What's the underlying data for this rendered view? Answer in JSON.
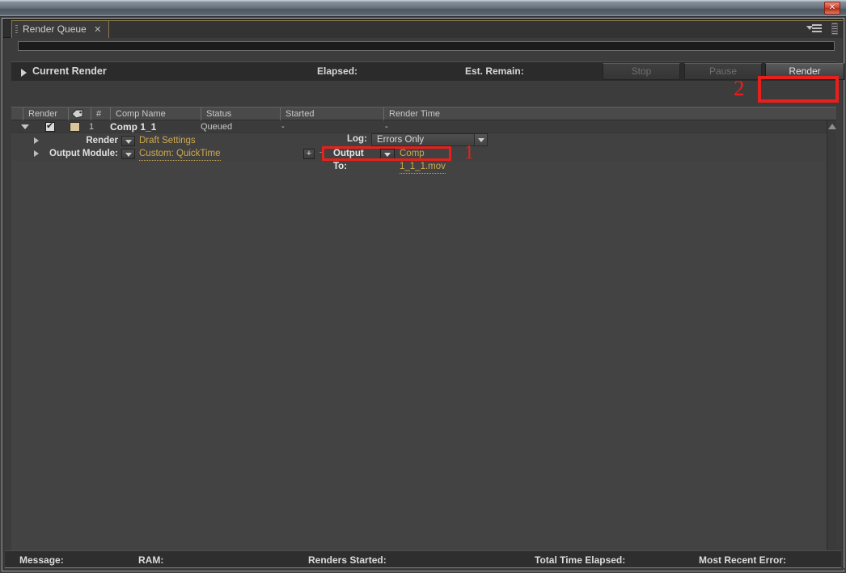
{
  "window": {
    "close_label": "✕"
  },
  "tab": {
    "label": "Render Queue",
    "close": "✕"
  },
  "current_render": {
    "title": "Current Render",
    "elapsed_label": "Elapsed:",
    "elapsed_value": "",
    "remain_label": "Est. Remain:",
    "remain_value": "",
    "stop_label": "Stop",
    "pause_label": "Pause",
    "render_label": "Render"
  },
  "annotations": {
    "one": "1",
    "two": "2",
    "color": "#e8201b"
  },
  "columns": {
    "render": "Render",
    "label": "",
    "number": "#",
    "comp_name": "Comp Name",
    "status": "Status",
    "started": "Started",
    "render_time": "Render Time"
  },
  "queue_item": {
    "number": "1",
    "comp_name": "Comp 1_1",
    "status": "Queued",
    "started": "-",
    "render_time": "-",
    "swatch_color": "#d9c49b",
    "render_settings": {
      "label": "Render Settings:",
      "value": "Draft Settings"
    },
    "output_module": {
      "label": "Output Module:",
      "value": "Custom: QuickTime",
      "plus": "+",
      "minus": "−"
    },
    "log": {
      "label": "Log:",
      "value": "Errors Only"
    },
    "output_to": {
      "label": "Output To:",
      "value": "Comp 1_1_1.mov"
    }
  },
  "status_bar": {
    "message_label": "Message:",
    "ram_label": "RAM:",
    "renders_started_label": "Renders Started:",
    "total_time_label": "Total Time Elapsed:",
    "most_recent_error_label": "Most Recent Error:"
  }
}
